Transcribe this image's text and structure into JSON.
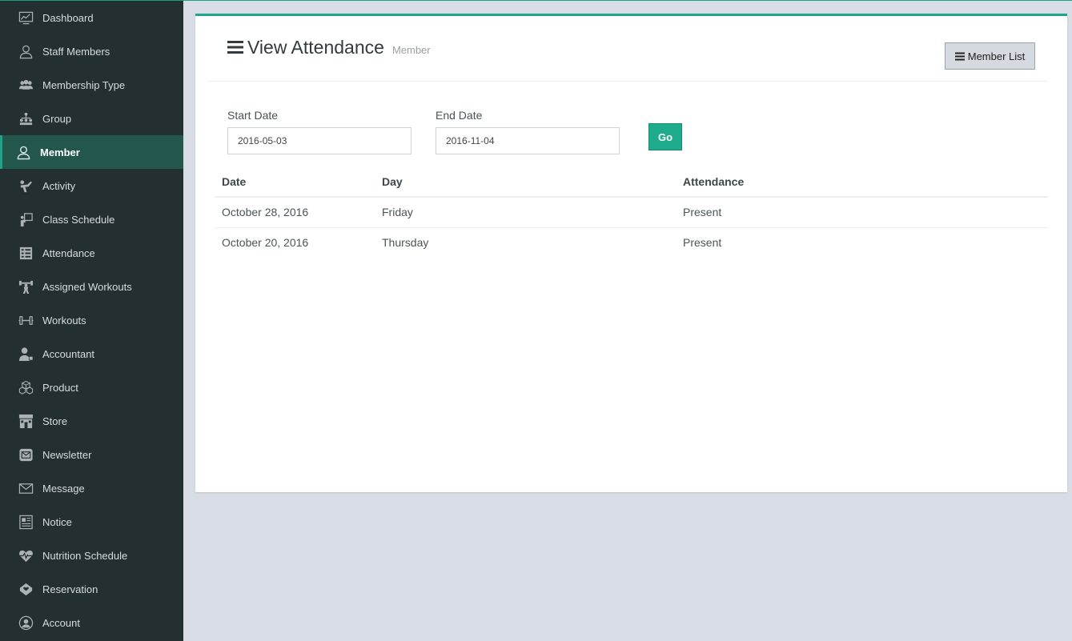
{
  "sidebar": {
    "items": [
      {
        "label": "Dashboard",
        "icon": "dashboard-icon"
      },
      {
        "label": "Staff Members",
        "icon": "staff-icon"
      },
      {
        "label": "Membership Type",
        "icon": "membership-icon"
      },
      {
        "label": "Group",
        "icon": "group-icon"
      },
      {
        "label": "Member",
        "icon": "member-icon",
        "active": true
      },
      {
        "label": "Activity",
        "icon": "activity-icon"
      },
      {
        "label": "Class Schedule",
        "icon": "class-schedule-icon"
      },
      {
        "label": "Attendance",
        "icon": "attendance-icon"
      },
      {
        "label": "Assigned Workouts",
        "icon": "assigned-workouts-icon"
      },
      {
        "label": "Workouts",
        "icon": "dumbbell-icon"
      },
      {
        "label": "Accountant",
        "icon": "accountant-icon"
      },
      {
        "label": "Product",
        "icon": "product-icon"
      },
      {
        "label": "Store",
        "icon": "store-icon"
      },
      {
        "label": "Newsletter",
        "icon": "newsletter-icon"
      },
      {
        "label": "Message",
        "icon": "message-icon"
      },
      {
        "label": "Notice",
        "icon": "notice-icon"
      },
      {
        "label": "Nutrition Schedule",
        "icon": "nutrition-icon"
      },
      {
        "label": "Reservation",
        "icon": "reservation-icon"
      },
      {
        "label": "Account",
        "icon": "account-icon"
      }
    ],
    "colors": {
      "background": "#242f32",
      "active_bg": "#23564d",
      "accent": "#1fa386"
    }
  },
  "header": {
    "title": "View Attendance",
    "subtitle": "Member",
    "member_list_button": "Member List"
  },
  "filter": {
    "start_label": "Start Date",
    "start_value": "2016-05-03",
    "end_label": "End Date",
    "end_value": "2016-11-04",
    "go_label": "Go"
  },
  "table": {
    "columns": [
      "Date",
      "Day",
      "Attendance"
    ],
    "rows": [
      [
        "October 28, 2016",
        "Friday",
        "Present"
      ],
      [
        "October 20, 2016",
        "Thursday",
        "Present"
      ]
    ]
  },
  "colors": {
    "accent_green": "#1fac8d",
    "page_bg": "#d8dde5"
  }
}
